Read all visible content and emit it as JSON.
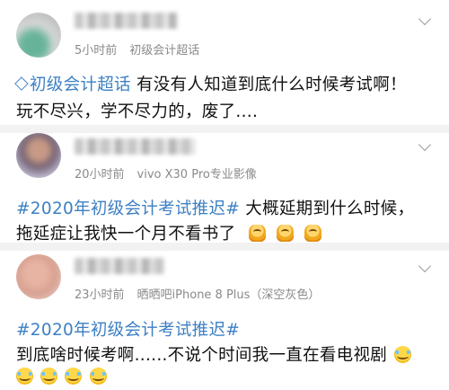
{
  "posts": [
    {
      "time": "5小时前",
      "source": "初级会计超话",
      "lines": [
        {
          "topic": "初级会计超话",
          "text": " 有没有人知道到底什么时候考试啊！"
        },
        {
          "text": "玩不尽兴，学不尽力的，废了...."
        }
      ]
    },
    {
      "time": "20小时前",
      "source": "vivo X30 Pro专业影像",
      "lines": [
        {
          "topic": "#2020年初级会计考试推迟#",
          "text": "   大概延期到什么时候，"
        },
        {
          "text": "拖延症让我快一个月不看书了"
        }
      ],
      "emojis": [
        "doll-emoji",
        "doll-emoji",
        "doll-emoji"
      ]
    },
    {
      "time": "23小时前",
      "source": "晒晒吧iPhone 8 Plus（深空灰色）",
      "lines": [
        {
          "topic": "#2020年初级会计考试推迟#"
        },
        {
          "text": "到底啥时候考啊......不说个时间我一直在看电视剧"
        }
      ],
      "emojis": [
        "cry-laugh-emoji",
        "cry-laugh-emoji",
        "cry-laugh-emoji",
        "cry-laugh-emoji",
        "cry-laugh-emoji"
      ]
    }
  ],
  "colors": {
    "topic": "#3d80c4",
    "meta": "#8a8a8a",
    "divider": "#f2f2f2"
  }
}
